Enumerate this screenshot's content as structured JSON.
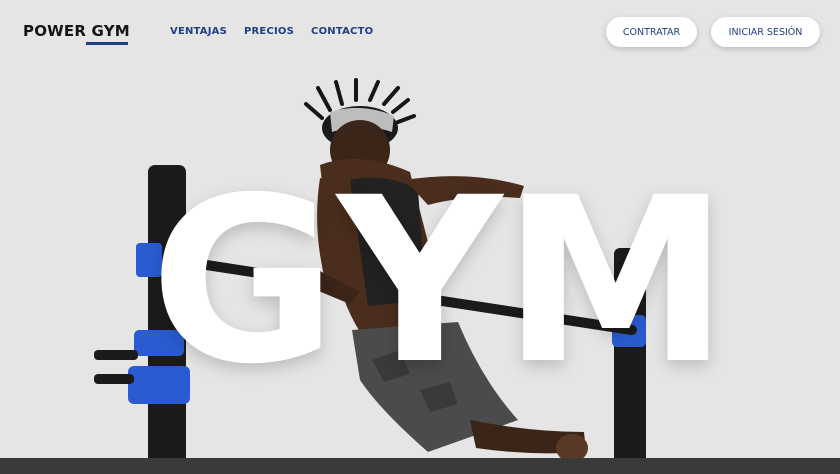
{
  "brand": {
    "name": "POWER GYM"
  },
  "nav": {
    "items": [
      {
        "label": "VENTAJAS"
      },
      {
        "label": "PRECIOS"
      },
      {
        "label": "CONTACTO"
      }
    ]
  },
  "actions": {
    "contratar_label": "CONTRATAR",
    "login_label": "INICIAR SESIÓN"
  },
  "hero": {
    "headline_letters": [
      "G",
      "Y",
      "M"
    ],
    "image_subject": "athlete-doing-bar-dips"
  },
  "colors": {
    "accent": "#1f3f86",
    "background": "#e5e5e5",
    "button_bg": "#ffffff",
    "headline": "#ffffff"
  }
}
